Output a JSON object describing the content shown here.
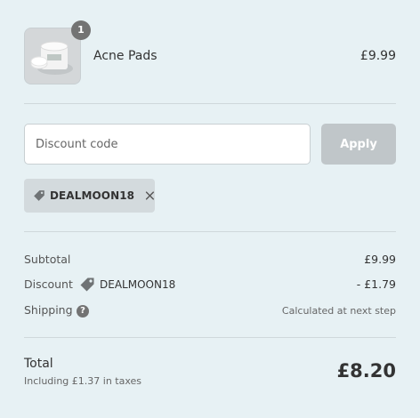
{
  "product": {
    "quantity": "1",
    "name": "Acne Pads",
    "price": "£9.99",
    "image_icon": "acne-pads-jar-image"
  },
  "discount_form": {
    "placeholder": "Discount code",
    "value": "",
    "apply_label": "Apply",
    "applied_code": "DEALMOON18"
  },
  "summary": {
    "subtotal_label": "Subtotal",
    "subtotal_value": "£9.99",
    "discount_label": "Discount",
    "discount_code": "DEALMOON18",
    "discount_value": "- £1.79",
    "shipping_label": "Shipping",
    "shipping_help": "?",
    "shipping_value": "Calculated at next step"
  },
  "total": {
    "label": "Total",
    "tax_note": "Including £1.37 in taxes",
    "value": "£8.20"
  },
  "colors": {
    "background": "#e7f1f4",
    "apply_button": "#c0c6c9",
    "tag_background": "#d3dadd",
    "badge": "#737373"
  }
}
